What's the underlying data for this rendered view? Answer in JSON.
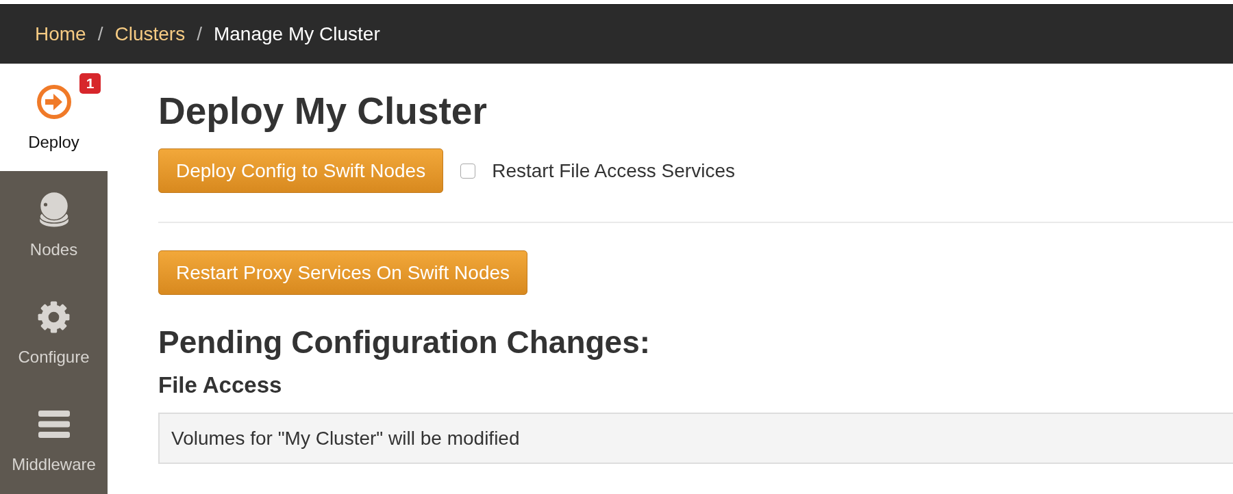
{
  "breadcrumb": [
    {
      "kind": "link",
      "label": "Home"
    },
    {
      "kind": "separator",
      "label": "/"
    },
    {
      "kind": "link",
      "label": "Clusters"
    },
    {
      "kind": "separator",
      "label": "/"
    },
    {
      "kind": "current",
      "label": "Manage My Cluster"
    }
  ],
  "sidebar": {
    "items": [
      {
        "label": "Deploy",
        "selected": true,
        "badge": "1"
      },
      {
        "label": "Nodes",
        "selected": false
      },
      {
        "label": "Configure",
        "selected": false
      },
      {
        "label": "Middleware",
        "selected": false
      }
    ]
  },
  "page": {
    "title": "Deploy My Cluster",
    "deploy_button": "Deploy Config to Swift Nodes",
    "restart_option": {
      "label": "Restart File Access Services",
      "checked": false
    },
    "restart_proxy_button": "Restart Proxy Services On Swift Nodes",
    "pending": {
      "title": "Pending Configuration Changes:",
      "sections": [
        {
          "title": "File Access",
          "messages": [
            "Volumes for \"My Cluster\" will be modified"
          ]
        }
      ]
    }
  }
}
